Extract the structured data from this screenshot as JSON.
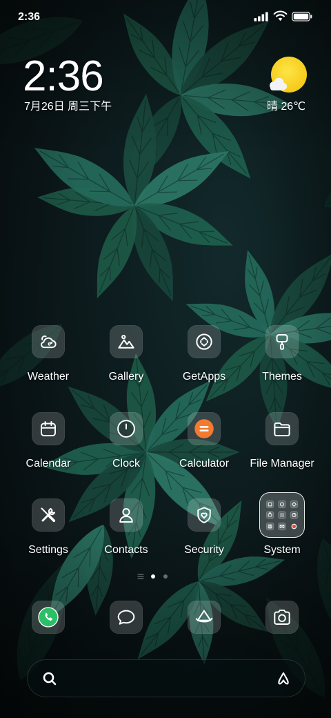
{
  "status_bar": {
    "time": "2:36",
    "signal_icon": "signal-icon",
    "signal_bars": 4,
    "signal_bars_max": 4,
    "wifi_icon": "wifi-icon",
    "battery_icon": "battery-icon",
    "battery_level": 1.0
  },
  "clock_widget": {
    "time": "2:36",
    "date": "7月26日 周三下午"
  },
  "weather_widget": {
    "icon": "sun-behind-cloud-icon",
    "text": "晴 26℃"
  },
  "app_grid": [
    {
      "label": "Weather",
      "icon": "weather-icon"
    },
    {
      "label": "Gallery",
      "icon": "gallery-icon"
    },
    {
      "label": "GetApps",
      "icon": "getapps-icon"
    },
    {
      "label": "Themes",
      "icon": "themes-icon"
    },
    {
      "label": "Calendar",
      "icon": "calendar-icon"
    },
    {
      "label": "Clock",
      "icon": "clock-icon"
    },
    {
      "label": "Calculator",
      "icon": "calculator-icon"
    },
    {
      "label": "File Manager",
      "icon": "folder-icon"
    },
    {
      "label": "Settings",
      "icon": "settings-tools-icon"
    },
    {
      "label": "Contacts",
      "icon": "contact-person-icon"
    },
    {
      "label": "Security",
      "icon": "shield-heart-icon"
    },
    {
      "label": "System",
      "icon": "system-folder-icon"
    }
  ],
  "page_indicator": {
    "icon": "feed-lines-icon",
    "page_count": 2,
    "active_page": 1
  },
  "dock": [
    {
      "icon": "phone-icon"
    },
    {
      "icon": "messages-icon"
    },
    {
      "icon": "browser-icon"
    },
    {
      "icon": "camera-icon"
    }
  ],
  "search_bar": {
    "search_icon": "search-icon",
    "assistant_icon": "assistant-icon"
  },
  "colors": {
    "sun_yellow": "#f9d423",
    "calculator_orange": "#f47a30",
    "phone_green": "#2bbf68",
    "notification_red": "#e5473d",
    "wallpaper_base": "#0b1719",
    "leaf_green": "#22624f"
  }
}
